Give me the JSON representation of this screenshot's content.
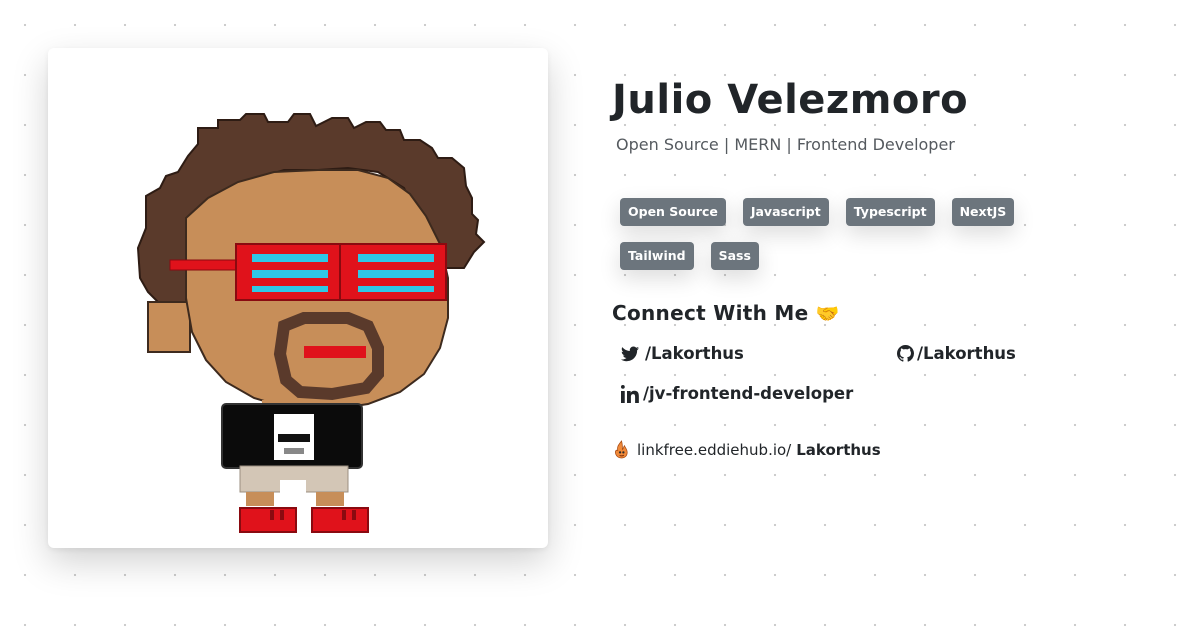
{
  "profile": {
    "name": "Julio Velezmoro",
    "subtitle": "Open Source | MERN | Frontend Developer"
  },
  "tags": [
    "Open Source",
    "Javascript",
    "Typescript",
    "NextJS",
    "Tailwind",
    "Sass"
  ],
  "connect": {
    "title": "Connect With Me",
    "emoji": "🤝",
    "twitter": {
      "icon": "twitter-icon",
      "label": "/Lakorthus"
    },
    "github": {
      "icon": "github-icon",
      "label": "/Lakorthus"
    },
    "linkedin": {
      "icon": "linkedin-icon",
      "label": "/jv-frontend-developer"
    }
  },
  "linkfree": {
    "icon": "linkfree-logo-icon",
    "prefix": "linkfree.eddiehub.io/",
    "username": "Lakorthus"
  },
  "colors": {
    "tag_bg": "#6c757d",
    "text": "#212529",
    "subtitle": "#555a5f"
  }
}
